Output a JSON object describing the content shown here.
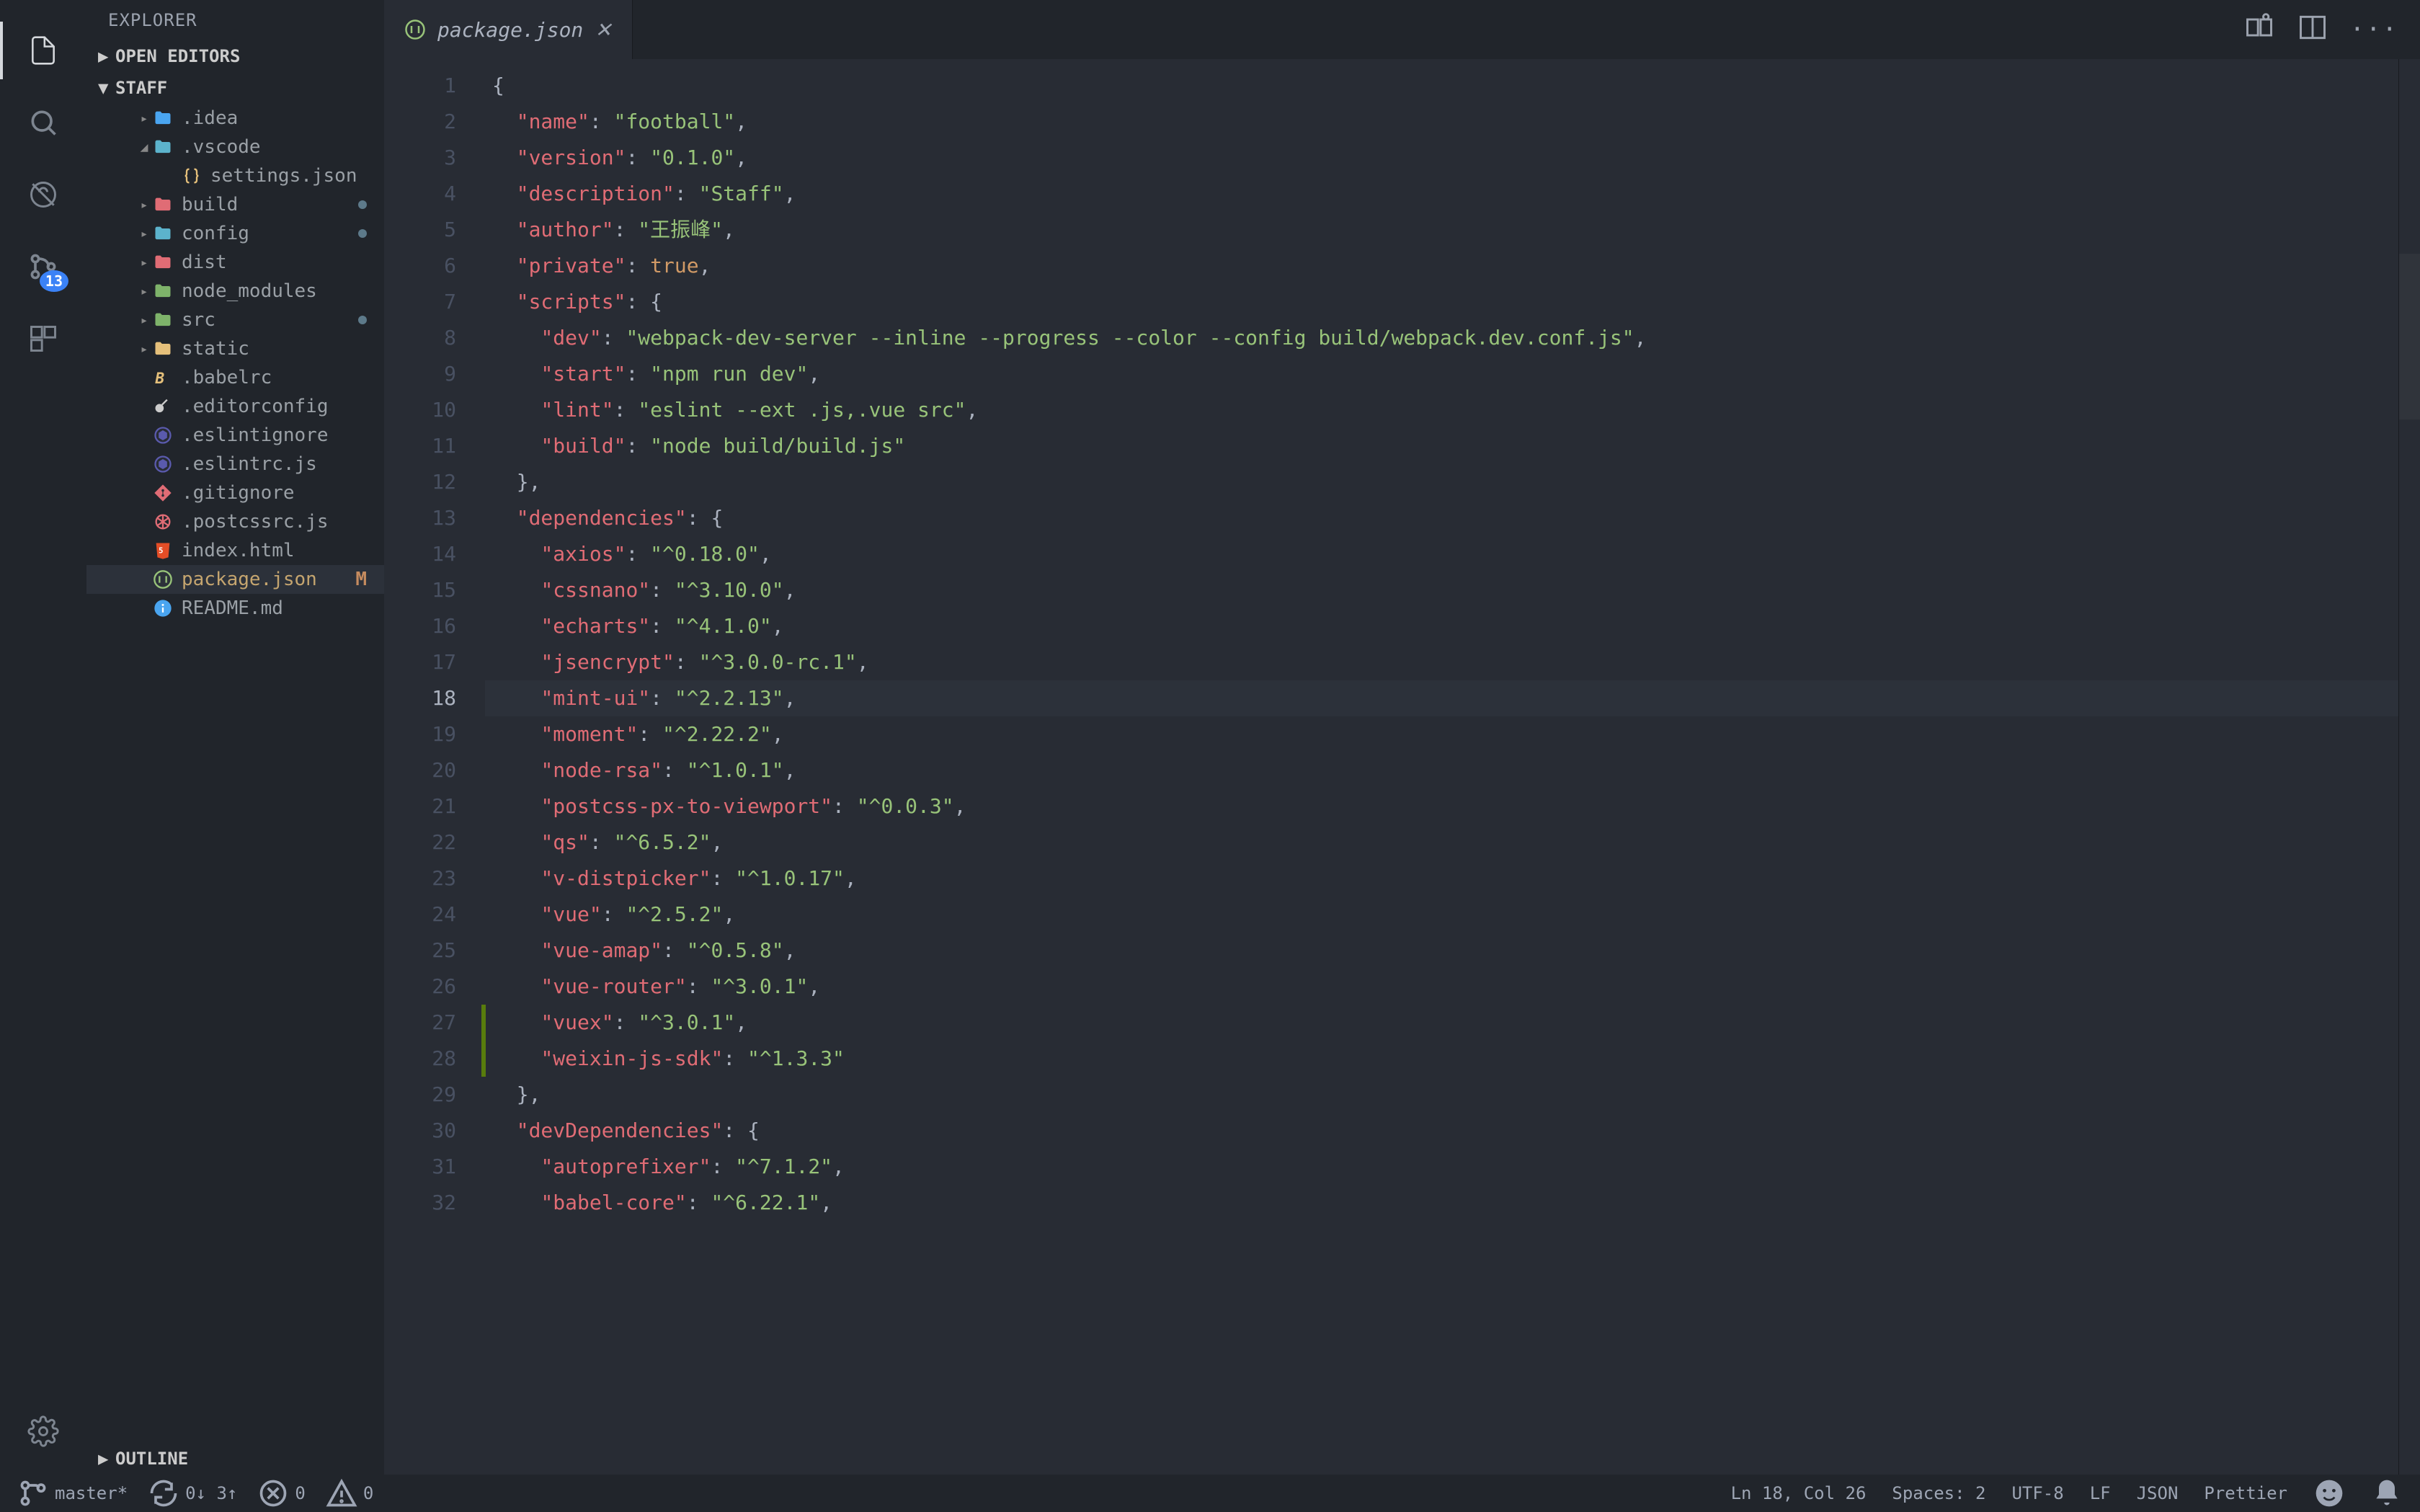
{
  "activity": {
    "scm_badge": "13"
  },
  "sidebar": {
    "title": "EXPLORER",
    "sections": {
      "open_editors": "OPEN EDITORS",
      "root": "STAFF",
      "outline": "OUTLINE"
    },
    "tree": [
      {
        "label": ".idea",
        "type": "folder",
        "indent": 1,
        "chev": "▶",
        "color": "folder-blue"
      },
      {
        "label": ".vscode",
        "type": "folder",
        "indent": 1,
        "chev": "▼",
        "color": "folder-teal"
      },
      {
        "label": "settings.json",
        "type": "file",
        "indent": 2,
        "icon": "json"
      },
      {
        "label": "build",
        "type": "folder",
        "indent": 1,
        "chev": "▶",
        "color": "folder-red",
        "dot": true
      },
      {
        "label": "config",
        "type": "folder",
        "indent": 1,
        "chev": "▶",
        "color": "folder-teal",
        "dot": true
      },
      {
        "label": "dist",
        "type": "folder",
        "indent": 1,
        "chev": "▶",
        "color": "folder-red"
      },
      {
        "label": "node_modules",
        "type": "folder",
        "indent": 1,
        "chev": "▶",
        "color": "folder-green"
      },
      {
        "label": "src",
        "type": "folder",
        "indent": 1,
        "chev": "▶",
        "color": "folder-green",
        "dot": true
      },
      {
        "label": "static",
        "type": "folder",
        "indent": 1,
        "chev": "▶",
        "color": "folder-yellow"
      },
      {
        "label": ".babelrc",
        "type": "file",
        "indent": 1,
        "icon": "babel"
      },
      {
        "label": ".editorconfig",
        "type": "file",
        "indent": 1,
        "icon": "editorconfig"
      },
      {
        "label": ".eslintignore",
        "type": "file",
        "indent": 1,
        "icon": "eslint"
      },
      {
        "label": ".eslintrc.js",
        "type": "file",
        "indent": 1,
        "icon": "eslint"
      },
      {
        "label": ".gitignore",
        "type": "file",
        "indent": 1,
        "icon": "git"
      },
      {
        "label": ".postcssrc.js",
        "type": "file",
        "indent": 1,
        "icon": "postcss"
      },
      {
        "label": "index.html",
        "type": "file",
        "indent": 1,
        "icon": "html"
      },
      {
        "label": "package.json",
        "type": "file",
        "indent": 1,
        "icon": "npm",
        "selected": true,
        "git": "M",
        "modified": true
      },
      {
        "label": "README.md",
        "type": "file",
        "indent": 1,
        "icon": "info"
      }
    ]
  },
  "tabs": {
    "active": "package.json"
  },
  "editor": {
    "current_line": 18,
    "lines": [
      "{",
      "  \"name\": \"football\",",
      "  \"version\": \"0.1.0\",",
      "  \"description\": \"Staff\",",
      "  \"author\": \"王振峰\",",
      "  \"private\": true,",
      "  \"scripts\": {",
      "    \"dev\": \"webpack-dev-server --inline --progress --color --config build/webpack.dev.conf.js\",",
      "    \"start\": \"npm run dev\",",
      "    \"lint\": \"eslint --ext .js,.vue src\",",
      "    \"build\": \"node build/build.js\"",
      "  },",
      "  \"dependencies\": {",
      "    \"axios\": \"^0.18.0\",",
      "    \"cssnano\": \"^3.10.0\",",
      "    \"echarts\": \"^4.1.0\",",
      "    \"jsencrypt\": \"^3.0.0-rc.1\",",
      "    \"mint-ui\": \"^2.2.13\",",
      "    \"moment\": \"^2.22.2\",",
      "    \"node-rsa\": \"^1.0.1\",",
      "    \"postcss-px-to-viewport\": \"^0.0.3\",",
      "    \"qs\": \"^6.5.2\",",
      "    \"v-distpicker\": \"^1.0.17\",",
      "    \"vue\": \"^2.5.2\",",
      "    \"vue-amap\": \"^0.5.8\",",
      "    \"vue-router\": \"^3.0.1\",",
      "    \"vuex\": \"^3.0.1\",",
      "    \"weixin-js-sdk\": \"^1.3.3\"",
      "  },",
      "  \"devDependencies\": {",
      "    \"autoprefixer\": \"^7.1.2\",",
      "    \"babel-core\": \"^6.22.1\","
    ]
  },
  "statusbar": {
    "branch": "master*",
    "sync": "0↓ 3↑",
    "errors": "0",
    "warnings": "0",
    "position": "Ln 18, Col 26",
    "spaces": "Spaces: 2",
    "encoding": "UTF-8",
    "eol": "LF",
    "lang": "JSON",
    "formatter": "Prettier"
  }
}
